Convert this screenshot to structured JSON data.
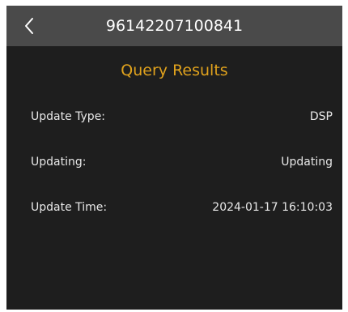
{
  "header": {
    "title": "96142207100841",
    "back_icon": "chevron-left-icon"
  },
  "section": {
    "title": "Query Results"
  },
  "rows": [
    {
      "label": "Update Type:",
      "value": "DSP"
    },
    {
      "label": "Updating:",
      "value": "Updating"
    },
    {
      "label": "Update Time:",
      "value": "2024-01-17 16:10:03"
    }
  ],
  "colors": {
    "background": "#1e1e1e",
    "header": "#4a4a4a",
    "accent": "#e0a21d",
    "text": "#e8e8e8"
  }
}
